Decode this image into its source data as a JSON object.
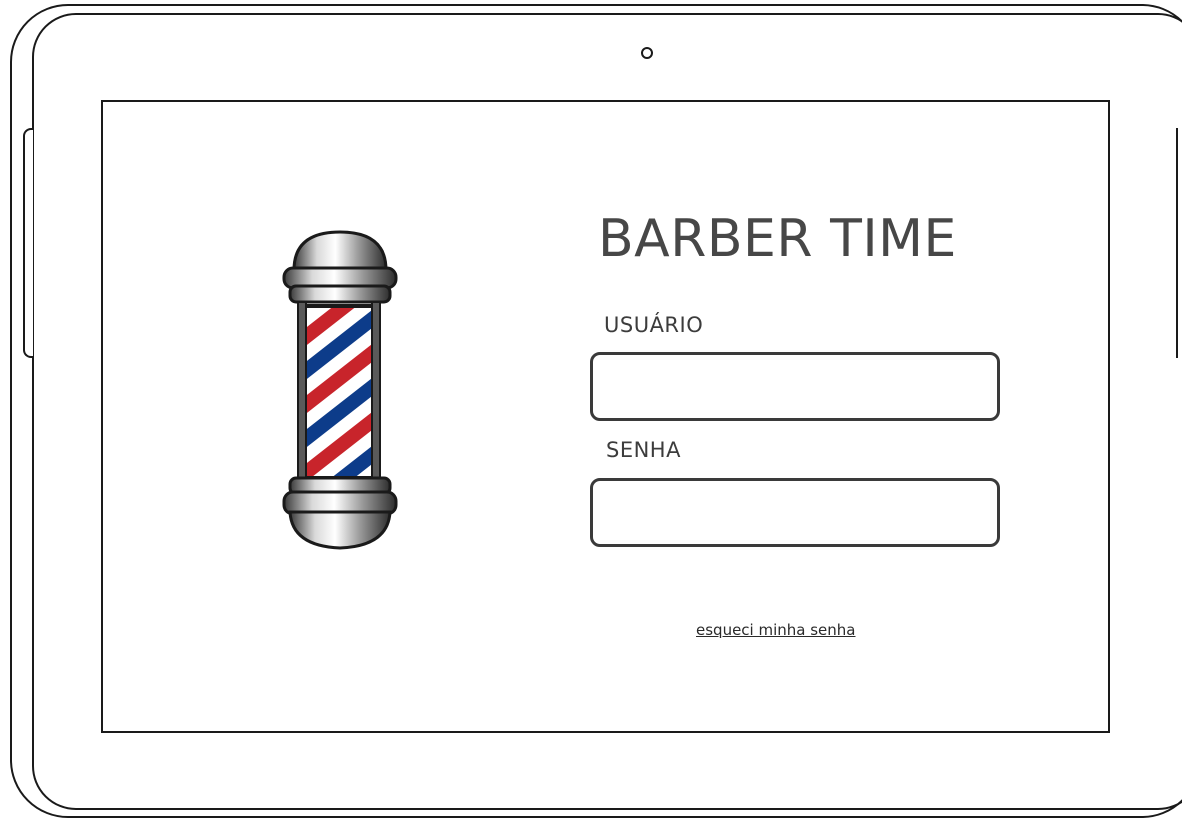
{
  "app": {
    "title": "BARBER TIME"
  },
  "login": {
    "username_label": "USUÁRIO",
    "username_value": "",
    "username_placeholder": "",
    "password_label": "SENHA",
    "password_value": "",
    "password_placeholder": "",
    "forgot_password_link": "esqueci minha senha"
  },
  "logo": {
    "icon": "barber-pole-icon",
    "stripe_colors": [
      "#c8242b",
      "#ffffff",
      "#0d3c8a"
    ]
  },
  "colors": {
    "text": "#474747",
    "border": "#3a3a3a",
    "frame": "#1a1a1a"
  }
}
